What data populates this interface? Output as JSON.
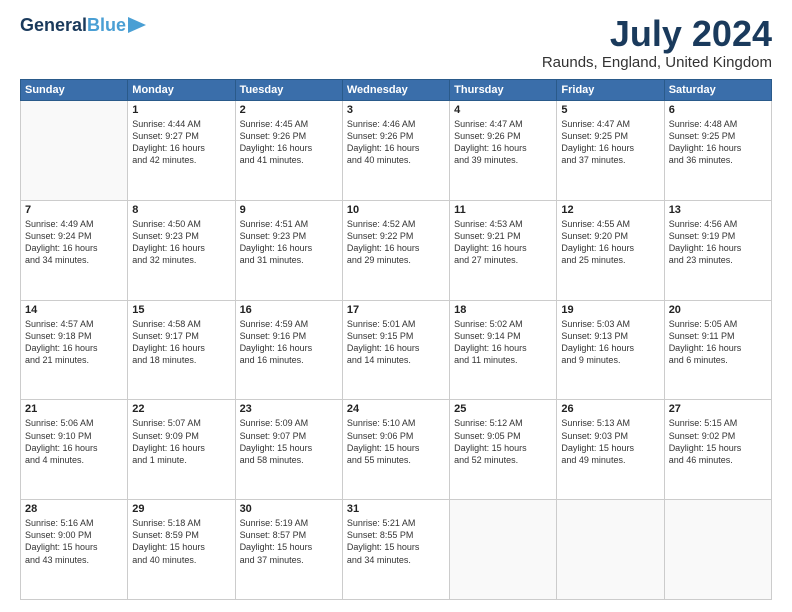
{
  "logo": {
    "line1": "General",
    "line2": "Blue"
  },
  "title": "July 2024",
  "location": "Raunds, England, United Kingdom",
  "days_of_week": [
    "Sunday",
    "Monday",
    "Tuesday",
    "Wednesday",
    "Thursday",
    "Friday",
    "Saturday"
  ],
  "weeks": [
    [
      {
        "day": "",
        "content": ""
      },
      {
        "day": "1",
        "content": "Sunrise: 4:44 AM\nSunset: 9:27 PM\nDaylight: 16 hours\nand 42 minutes."
      },
      {
        "day": "2",
        "content": "Sunrise: 4:45 AM\nSunset: 9:26 PM\nDaylight: 16 hours\nand 41 minutes."
      },
      {
        "day": "3",
        "content": "Sunrise: 4:46 AM\nSunset: 9:26 PM\nDaylight: 16 hours\nand 40 minutes."
      },
      {
        "day": "4",
        "content": "Sunrise: 4:47 AM\nSunset: 9:26 PM\nDaylight: 16 hours\nand 39 minutes."
      },
      {
        "day": "5",
        "content": "Sunrise: 4:47 AM\nSunset: 9:25 PM\nDaylight: 16 hours\nand 37 minutes."
      },
      {
        "day": "6",
        "content": "Sunrise: 4:48 AM\nSunset: 9:25 PM\nDaylight: 16 hours\nand 36 minutes."
      }
    ],
    [
      {
        "day": "7",
        "content": "Sunrise: 4:49 AM\nSunset: 9:24 PM\nDaylight: 16 hours\nand 34 minutes."
      },
      {
        "day": "8",
        "content": "Sunrise: 4:50 AM\nSunset: 9:23 PM\nDaylight: 16 hours\nand 32 minutes."
      },
      {
        "day": "9",
        "content": "Sunrise: 4:51 AM\nSunset: 9:23 PM\nDaylight: 16 hours\nand 31 minutes."
      },
      {
        "day": "10",
        "content": "Sunrise: 4:52 AM\nSunset: 9:22 PM\nDaylight: 16 hours\nand 29 minutes."
      },
      {
        "day": "11",
        "content": "Sunrise: 4:53 AM\nSunset: 9:21 PM\nDaylight: 16 hours\nand 27 minutes."
      },
      {
        "day": "12",
        "content": "Sunrise: 4:55 AM\nSunset: 9:20 PM\nDaylight: 16 hours\nand 25 minutes."
      },
      {
        "day": "13",
        "content": "Sunrise: 4:56 AM\nSunset: 9:19 PM\nDaylight: 16 hours\nand 23 minutes."
      }
    ],
    [
      {
        "day": "14",
        "content": "Sunrise: 4:57 AM\nSunset: 9:18 PM\nDaylight: 16 hours\nand 21 minutes."
      },
      {
        "day": "15",
        "content": "Sunrise: 4:58 AM\nSunset: 9:17 PM\nDaylight: 16 hours\nand 18 minutes."
      },
      {
        "day": "16",
        "content": "Sunrise: 4:59 AM\nSunset: 9:16 PM\nDaylight: 16 hours\nand 16 minutes."
      },
      {
        "day": "17",
        "content": "Sunrise: 5:01 AM\nSunset: 9:15 PM\nDaylight: 16 hours\nand 14 minutes."
      },
      {
        "day": "18",
        "content": "Sunrise: 5:02 AM\nSunset: 9:14 PM\nDaylight: 16 hours\nand 11 minutes."
      },
      {
        "day": "19",
        "content": "Sunrise: 5:03 AM\nSunset: 9:13 PM\nDaylight: 16 hours\nand 9 minutes."
      },
      {
        "day": "20",
        "content": "Sunrise: 5:05 AM\nSunset: 9:11 PM\nDaylight: 16 hours\nand 6 minutes."
      }
    ],
    [
      {
        "day": "21",
        "content": "Sunrise: 5:06 AM\nSunset: 9:10 PM\nDaylight: 16 hours\nand 4 minutes."
      },
      {
        "day": "22",
        "content": "Sunrise: 5:07 AM\nSunset: 9:09 PM\nDaylight: 16 hours\nand 1 minute."
      },
      {
        "day": "23",
        "content": "Sunrise: 5:09 AM\nSunset: 9:07 PM\nDaylight: 15 hours\nand 58 minutes."
      },
      {
        "day": "24",
        "content": "Sunrise: 5:10 AM\nSunset: 9:06 PM\nDaylight: 15 hours\nand 55 minutes."
      },
      {
        "day": "25",
        "content": "Sunrise: 5:12 AM\nSunset: 9:05 PM\nDaylight: 15 hours\nand 52 minutes."
      },
      {
        "day": "26",
        "content": "Sunrise: 5:13 AM\nSunset: 9:03 PM\nDaylight: 15 hours\nand 49 minutes."
      },
      {
        "day": "27",
        "content": "Sunrise: 5:15 AM\nSunset: 9:02 PM\nDaylight: 15 hours\nand 46 minutes."
      }
    ],
    [
      {
        "day": "28",
        "content": "Sunrise: 5:16 AM\nSunset: 9:00 PM\nDaylight: 15 hours\nand 43 minutes."
      },
      {
        "day": "29",
        "content": "Sunrise: 5:18 AM\nSunset: 8:59 PM\nDaylight: 15 hours\nand 40 minutes."
      },
      {
        "day": "30",
        "content": "Sunrise: 5:19 AM\nSunset: 8:57 PM\nDaylight: 15 hours\nand 37 minutes."
      },
      {
        "day": "31",
        "content": "Sunrise: 5:21 AM\nSunset: 8:55 PM\nDaylight: 15 hours\nand 34 minutes."
      },
      {
        "day": "",
        "content": ""
      },
      {
        "day": "",
        "content": ""
      },
      {
        "day": "",
        "content": ""
      }
    ]
  ]
}
